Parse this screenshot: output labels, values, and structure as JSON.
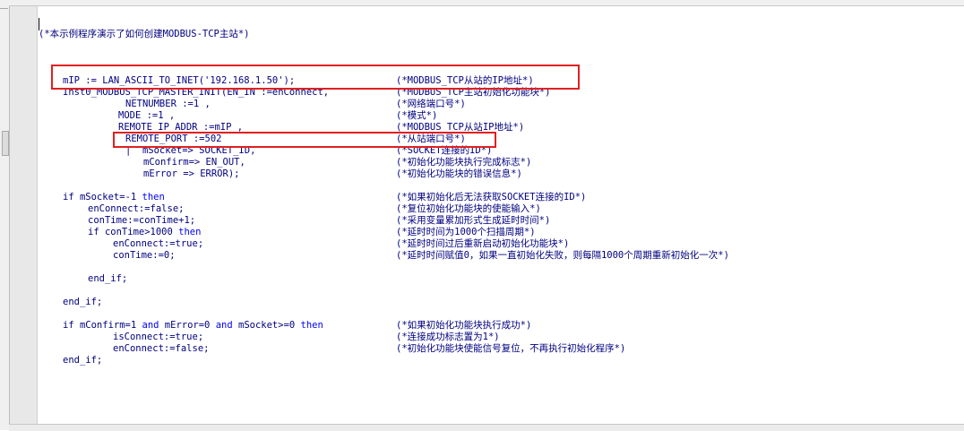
{
  "header_comment": "(*本示例程序演示了如何创建MODBUS-TCP主站*)",
  "code_lines": [
    {
      "code": "mIP := LAN_ASCII_TO_INET('192.168.1.50');",
      "comment": "(*MODBUS_TCP从站的IP地址*)"
    },
    {
      "code": "Inst0_MODBUS_TCP_MASTER_INIT(EN_IN :=enConnect,",
      "comment": "(*MODBUS_TCP主站初始化功能块*)"
    },
    {
      "code": "NETNUMBER :=1 ,",
      "comment": "(*网络端口号*)"
    },
    {
      "code": "MODE :=1 ,",
      "comment": "(*模式*)"
    },
    {
      "code": "REMOTE_IP_ADDR :=mIP ,",
      "comment": "(*MODBUS_TCP从站IP地址*)"
    },
    {
      "code": "REMOTE_PORT :=502",
      "comment": "(*从站端口号*)"
    },
    {
      "code": "|  mSocket=> SOCKET_ID,",
      "comment": "(*SOCKET连接的ID*)"
    },
    {
      "code": "mConfirm=> EN_OUT,",
      "comment": "(*初始化功能块执行完成标志*)"
    },
    {
      "code": "mError => ERROR);",
      "comment": "(*初始化功能块的错误信息*)"
    },
    {
      "code_pre": "if mSocket=-1 ",
      "code_kw": "then",
      "comment": "(*如果初始化后无法获取SOCKET连接的ID*)"
    },
    {
      "code": "enConnect:=false;",
      "comment": "(*复位初始化功能块的使能输入*)"
    },
    {
      "code": "conTime:=conTime+1;",
      "comment": "(*采用变量累加形式生成延时时间*)"
    },
    {
      "code_pre": "if conTime>1000 ",
      "code_kw": "then",
      "comment": "(*延时时间为1000个扫描周期*)"
    },
    {
      "code": "enConnect:=true;",
      "comment": "(*延时时间过后重新启动初始化功能块*)"
    },
    {
      "code": "conTime:=0;",
      "comment": "(*延时时间赋值0，如果一直初始化失败，则每隔1000个周期重新初始化一次*)"
    },
    {
      "code": "end_if;"
    },
    {
      "code": "end_if;"
    },
    {
      "code_a": "if mConfirm=1 ",
      "kw_and": "and",
      "code_b": " mError=0 ",
      "kw_and2": "and",
      "code_c": " mSocket>=0 ",
      "kw_then": "then",
      "comment": "(*如果初始化功能块执行成功*)"
    },
    {
      "code": "isConnect:=true;",
      "comment": "(*连接成功标志置为1*)"
    },
    {
      "code": "enConnect:=false;",
      "comment": "(*初始化功能块使能信号复位，不再执行初始化程序*)"
    },
    {
      "code": "end_if;"
    }
  ],
  "colors": {
    "highlight": "#e02020",
    "text": "#000080",
    "keyword": "#0000ff"
  }
}
